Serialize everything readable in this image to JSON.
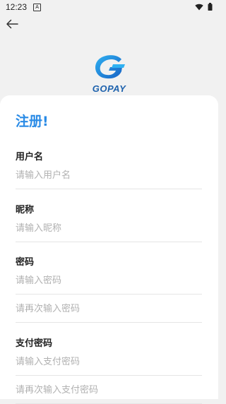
{
  "status": {
    "time": "12:23",
    "notif_icon": "A"
  },
  "brand": {
    "name": "GOPAY"
  },
  "form": {
    "title": "注册!",
    "username": {
      "label": "用户名",
      "placeholder": "请输入用户名"
    },
    "nickname": {
      "label": "昵称",
      "placeholder": "请输入昵称"
    },
    "password": {
      "label": "密码",
      "placeholder": "请输入密码",
      "confirm_placeholder": "请再次输入密码"
    },
    "pay_password": {
      "label": "支付密码",
      "placeholder": "请输入支付密码",
      "confirm_placeholder": "请再次输入支付密码"
    }
  },
  "colors": {
    "accent": "#2a8be6",
    "brand": "#1e62ad",
    "background": "#f1f1f1"
  }
}
